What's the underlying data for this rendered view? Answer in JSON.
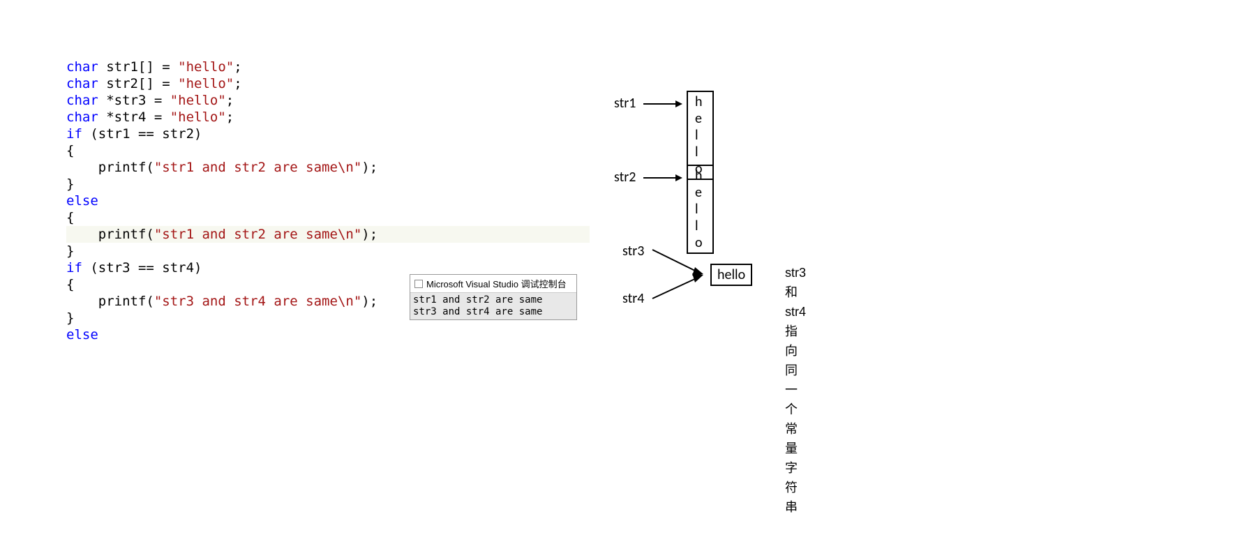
{
  "code": {
    "line1_kw": "char",
    "line1_rest": " str1[] = ",
    "line1_str": "\"hello\"",
    "line1_end": ";",
    "line2_kw": "char",
    "line2_rest": " str2[] = ",
    "line2_str": "\"hello\"",
    "line2_end": ";",
    "line3_kw": "char",
    "line3_rest": " *str3 = ",
    "line3_str": "\"hello\"",
    "line3_end": ";",
    "line4_kw": "char",
    "line4_rest": " *str4 = ",
    "line4_str": "\"hello\"",
    "line4_end": ";",
    "line5_kw": "if",
    "line5_rest": " (str1 == str2)",
    "line6": "{",
    "line7_pre": "    printf(",
    "line7_str": "\"str1 and str2 are same\\n\"",
    "line7_post": ");",
    "line8": "}",
    "line9_kw": "else",
    "line10": "{",
    "line11_pre": "    printf(",
    "line11_str": "\"str1 and str2 are same\\n\"",
    "line11_post": ");",
    "line12": "}",
    "line13_kw": "if",
    "line13_rest": " (str3 == str4)",
    "line14": "{",
    "line15_pre": "    printf(",
    "line15_str": "\"str3 and str4 are same\\n\"",
    "line15_post": ");",
    "line16": "}",
    "line17_kw": "else"
  },
  "console": {
    "title": "Microsoft Visual Studio 调试控制台",
    "out1": "str1 and str2 are same",
    "out2": "str3 and str4 are same"
  },
  "diagram": {
    "str1": "str1",
    "str2": "str2",
    "str3": "str3",
    "str4": "str4",
    "hello_spaced": "h e l l o",
    "hello": "hello",
    "note_l1": "str3 和 str4指向同一个",
    "note_l2": "常量字符串"
  }
}
